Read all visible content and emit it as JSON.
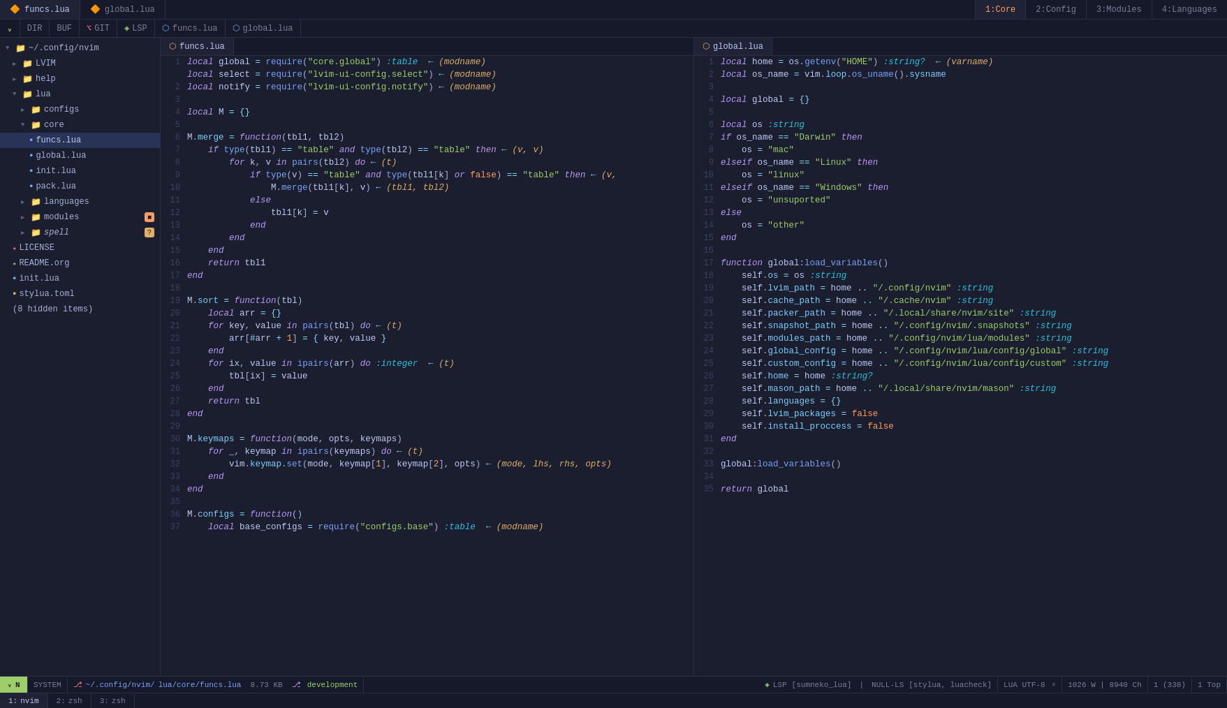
{
  "tabs": {
    "left": [
      {
        "label": "funcs.lua",
        "icon": "🔶",
        "active": true
      },
      {
        "label": "global.lua",
        "icon": "🔶",
        "active": false
      }
    ],
    "right": [
      {
        "num": "1:",
        "label": "Core",
        "active": true
      },
      {
        "num": "2:",
        "label": "Config",
        "active": false
      },
      {
        "num": "3:",
        "label": "Modules",
        "active": false
      },
      {
        "num": "4:",
        "label": "Languages",
        "active": false
      }
    ]
  },
  "toolbar": {
    "dir_label": "DIR",
    "buf_label": "BUF",
    "git_label": "GIT",
    "lsp_label": "LSP",
    "file1": "funcs.lua",
    "file2": "global.lua"
  },
  "sidebar": {
    "root": "~/.config/nvim",
    "items": [
      {
        "label": "LVIM",
        "indent": 1,
        "type": "folder",
        "open": false
      },
      {
        "label": "help",
        "indent": 1,
        "type": "folder",
        "open": false
      },
      {
        "label": "lua",
        "indent": 1,
        "type": "folder",
        "open": true
      },
      {
        "label": "configs",
        "indent": 2,
        "type": "folder",
        "open": false
      },
      {
        "label": "core",
        "indent": 2,
        "type": "folder",
        "open": true
      },
      {
        "label": "funcs.lua",
        "indent": 3,
        "type": "lua",
        "active": true
      },
      {
        "label": "global.lua",
        "indent": 3,
        "type": "lua"
      },
      {
        "label": "init.lua",
        "indent": 3,
        "type": "lua"
      },
      {
        "label": "pack.lua",
        "indent": 3,
        "type": "lua"
      },
      {
        "label": "languages",
        "indent": 2,
        "type": "folder",
        "open": false
      },
      {
        "label": "modules",
        "indent": 2,
        "type": "folder",
        "open": false,
        "badge": "orange"
      },
      {
        "label": "spell",
        "indent": 2,
        "type": "folder",
        "open": false,
        "italic": true,
        "badge": "yellow"
      },
      {
        "label": "LICENSE",
        "indent": 1,
        "type": "lic"
      },
      {
        "label": "README.org",
        "indent": 1,
        "type": "md"
      },
      {
        "label": "init.lua",
        "indent": 1,
        "type": "lua"
      },
      {
        "label": "stylua.toml",
        "indent": 1,
        "type": "toml"
      },
      {
        "label": "(8 hidden items)",
        "indent": 1,
        "type": "hidden"
      }
    ]
  },
  "funcs_code": [
    {
      "n": 1,
      "code": "local global = require(\"core.global\") :table  ← (modname)"
    },
    {
      "n": "",
      "code": "local select = require(\"lvim-ui-config.select\") ← (modname)"
    },
    {
      "n": 2,
      "code": "local notify = require(\"lvim-ui-config.notify\") ← (modname)"
    },
    {
      "n": 3,
      "code": ""
    },
    {
      "n": 4,
      "code": "local M = {}"
    },
    {
      "n": 5,
      "code": ""
    },
    {
      "n": 6,
      "code": "M.merge = function(tbl1, tbl2)"
    },
    {
      "n": 7,
      "code": "    if type(tbl1) == \"table\" and type(tbl2) == \"table\" then ← (v, v)"
    },
    {
      "n": 8,
      "code": "        for k, v in pairs(tbl2) do ← (t)"
    },
    {
      "n": 9,
      "code": "            if type(v) == \"table\" and type(tbl1[k] or false) == \"table\" then ← (v,"
    },
    {
      "n": 10,
      "code": "                M.merge(tbl1[k], v) ← (tbl1, tbl2)"
    },
    {
      "n": 11,
      "code": "            else"
    },
    {
      "n": 12,
      "code": "                tbl1[k] = v"
    },
    {
      "n": 13,
      "code": "            end"
    },
    {
      "n": 14,
      "code": "        end"
    },
    {
      "n": 15,
      "code": "    end"
    },
    {
      "n": 16,
      "code": "    return tbl1"
    },
    {
      "n": 17,
      "code": "end"
    },
    {
      "n": 18,
      "code": ""
    },
    {
      "n": 19,
      "code": "M.sort = function(tbl)"
    },
    {
      "n": 20,
      "code": "    local arr = {}"
    },
    {
      "n": 21,
      "code": "    for key, value in pairs(tbl) do ← (t)"
    },
    {
      "n": 22,
      "code": "        arr[#arr + 1] = { key, value }"
    },
    {
      "n": 23,
      "code": "    end"
    },
    {
      "n": 24,
      "code": "    for ix, value in ipairs(arr) do :integer  ← (t)"
    },
    {
      "n": 25,
      "code": "        tbl[ix] = value"
    },
    {
      "n": 26,
      "code": "    end"
    },
    {
      "n": 27,
      "code": "    return tbl"
    },
    {
      "n": 28,
      "code": "end"
    },
    {
      "n": 29,
      "code": ""
    },
    {
      "n": 30,
      "code": "M.keymaps = function(mode, opts, keymaps)"
    },
    {
      "n": 31,
      "code": "    for _, keymap in ipairs(keymaps) do ← (t)"
    },
    {
      "n": 32,
      "code": "        vim.keymap.set(mode, keymap[1], keymap[2], opts) ← (mode, lhs, rhs, opts)"
    },
    {
      "n": 33,
      "code": "    end"
    },
    {
      "n": 34,
      "code": "end"
    },
    {
      "n": 35,
      "code": ""
    },
    {
      "n": 36,
      "code": "M.configs = function()"
    },
    {
      "n": 37,
      "code": "    local base_configs = require(\"configs.base\") :table  ← (modname)"
    }
  ],
  "global_code": [
    {
      "n": 1,
      "code": "local home = os.getenv(\"HOME\") :string?  ← (varname)"
    },
    {
      "n": 2,
      "code": "local os_name = vim.loop.os_uname().sysname"
    },
    {
      "n": 3,
      "code": ""
    },
    {
      "n": 4,
      "code": "local global = {}"
    },
    {
      "n": 5,
      "code": ""
    },
    {
      "n": 6,
      "code": "local os :string"
    },
    {
      "n": 7,
      "code": "if os_name == \"Darwin\" then"
    },
    {
      "n": 8,
      "code": "    os = \"mac\""
    },
    {
      "n": 9,
      "code": "elseif os_name == \"Linux\" then"
    },
    {
      "n": 10,
      "code": "    os = \"linux\""
    },
    {
      "n": 11,
      "code": "elseif os_name == \"Windows\" then"
    },
    {
      "n": 12,
      "code": "    os = \"unsuported\""
    },
    {
      "n": 13,
      "code": "else"
    },
    {
      "n": 14,
      "code": "    os = \"other\""
    },
    {
      "n": 15,
      "code": "end"
    },
    {
      "n": 16,
      "code": ""
    },
    {
      "n": 17,
      "code": "function global:load_variables()"
    },
    {
      "n": 18,
      "code": "    self.os = os :string"
    },
    {
      "n": 19,
      "code": "    self.lvim_path = home .. \"/.config/nvim\" :string"
    },
    {
      "n": 20,
      "code": "    self.cache_path = home .. \"/.cache/nvim\" :string"
    },
    {
      "n": 21,
      "code": "    self.packer_path = home .. \"/.local/share/nvim/site\" :string"
    },
    {
      "n": 22,
      "code": "    self.snapshot_path = home .. \"/.config/nvim/.snapshots\" :string"
    },
    {
      "n": 23,
      "code": "    self.modules_path = home .. \"/.config/nvim/lua/modules\" :string"
    },
    {
      "n": 24,
      "code": "    self.global_config = home .. \"/.config/nvim/lua/config/global\" :string"
    },
    {
      "n": 25,
      "code": "    self.custom_config = home .. \"/.config/nvim/lua/config/custom\" :string"
    },
    {
      "n": 26,
      "code": "    self.home = home :string?"
    },
    {
      "n": 27,
      "code": "    self.mason_path = home .. \"/.local/share/nvim/mason\" :string"
    },
    {
      "n": 28,
      "code": "    self.languages = {}"
    },
    {
      "n": 29,
      "code": "    self.lvim_packages = false"
    },
    {
      "n": 30,
      "code": "    self.install_proccess = false"
    },
    {
      "n": 31,
      "code": "end"
    },
    {
      "n": 32,
      "code": ""
    },
    {
      "n": 33,
      "code": "global:load_variables()"
    },
    {
      "n": 34,
      "code": ""
    },
    {
      "n": 35,
      "code": "return global"
    }
  ],
  "status": {
    "mode": "N",
    "git_branch": "development",
    "file_path": "~/.config/nvim/",
    "file1": "lua/core/funcs.lua",
    "file_size": "8.73 KB",
    "lsp": "LSP",
    "lsp_name": "sumneko_lua",
    "null_ls": "NULL-LS",
    "null_ls_name": "stylua, luacheck",
    "encoding": "LUA UTF-8",
    "file_info": "1026 W | 8940 Ch",
    "position": "1 (338)",
    "top": "1 Top"
  },
  "bottom_tabs": [
    {
      "num": "1:",
      "label": "nvim",
      "active": true
    },
    {
      "num": "2:",
      "label": "zsh"
    },
    {
      "num": "3:",
      "label": "zsh"
    }
  ]
}
